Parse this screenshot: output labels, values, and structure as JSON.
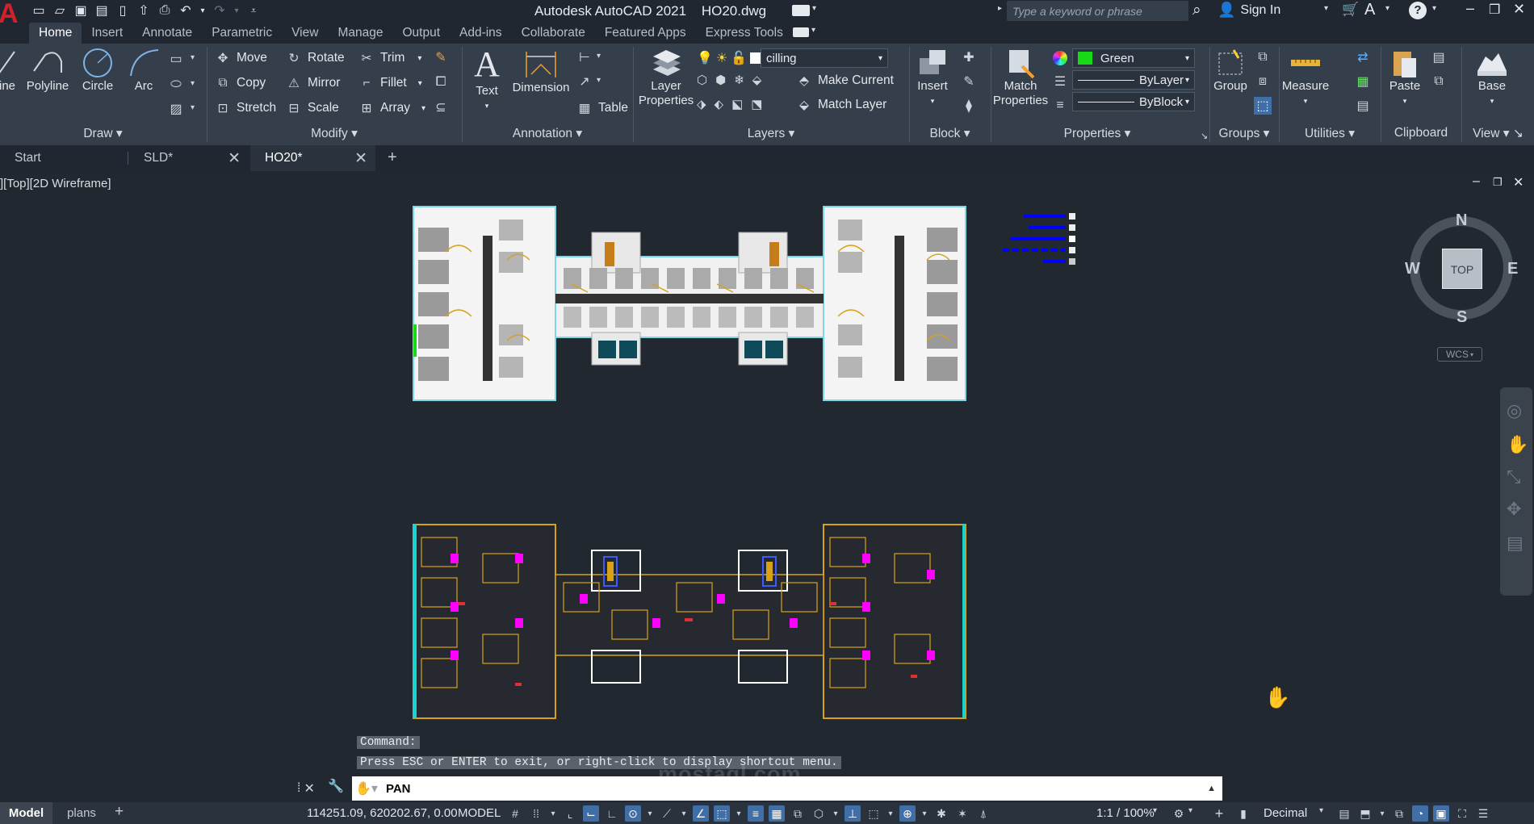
{
  "title_bar": {
    "app_title": "Autodesk AutoCAD 2021",
    "file_name": "HO20.dwg",
    "search_placeholder": "Type a keyword or phrase",
    "sign_in": "Sign In",
    "app_letter": "A"
  },
  "menu": {
    "tabs": [
      "Home",
      "Insert",
      "Annotate",
      "Parametric",
      "View",
      "Manage",
      "Output",
      "Add-ins",
      "Collaborate",
      "Featured Apps",
      "Express Tools"
    ],
    "active": "Home"
  },
  "ribbon": {
    "draw": {
      "panel": "Draw",
      "line": "ine",
      "polyline": "Polyline",
      "circle": "Circle",
      "arc": "Arc"
    },
    "modify": {
      "panel": "Modify",
      "move": "Move",
      "rotate": "Rotate",
      "trim": "Trim",
      "copy": "Copy",
      "mirror": "Mirror",
      "fillet": "Fillet",
      "stretch": "Stretch",
      "scale": "Scale",
      "array": "Array"
    },
    "annotation": {
      "panel": "Annotation",
      "text": "Text",
      "dimension": "Dimension",
      "table": "Table"
    },
    "layers": {
      "panel": "Layers",
      "layer_properties": "Layer Properties",
      "current_layer": "cilling",
      "make_current": "Make Current",
      "match_layer": "Match Layer"
    },
    "block": {
      "panel": "Block",
      "insert": "Insert"
    },
    "properties": {
      "panel": "Properties",
      "match_properties": "Match Properties",
      "color": "Green",
      "color_hex": "#18d918",
      "linetype": "ByLayer",
      "lineweight": "ByBlock"
    },
    "groups": {
      "panel": "Groups",
      "group": "Group"
    },
    "utilities": {
      "panel": "Utilities",
      "measure": "Measure"
    },
    "clipboard": {
      "panel": "Clipboard",
      "paste": "Paste"
    },
    "view": {
      "panel": "View",
      "base": "Base"
    }
  },
  "file_tabs": [
    {
      "label": "Start",
      "closable": false
    },
    {
      "label": "SLD*",
      "closable": true
    },
    {
      "label": "HO20*",
      "closable": true,
      "active": true
    }
  ],
  "viewport": {
    "label": "][Top][2D Wireframe]",
    "viewcube": {
      "face": "TOP",
      "n": "N",
      "s": "S",
      "e": "E",
      "w": "W",
      "wcs": "WCS"
    }
  },
  "command_line": {
    "history": [
      "Command:",
      "Press ESC or ENTER to exit, or right-click to display shortcut menu."
    ],
    "current": "PAN",
    "watermark_text": "mostaql.com"
  },
  "status_bar": {
    "layout_tabs": [
      "Model",
      "plans"
    ],
    "coordinates": "114251.09, 620202.67, 0.00",
    "space": "MODEL",
    "annotation_scale": "1:1 / 100%",
    "units": "Decimal"
  },
  "colors": {
    "titlebar": "#202731",
    "ribbon": "#353e4b",
    "canvas": "#212830",
    "accent_blue": "#3f6fa6",
    "cad_yellow": "#d6a21a",
    "cad_magenta": "#ff00ff",
    "cad_cyan": "#19d3d3",
    "legend_blue": "#0000ff"
  }
}
